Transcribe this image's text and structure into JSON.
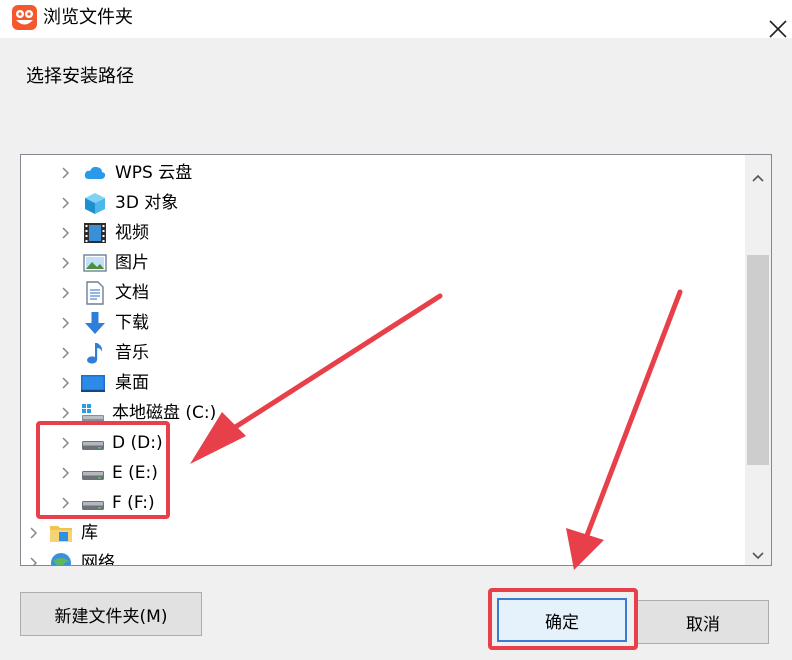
{
  "window": {
    "title": "浏览文件夹",
    "close_icon": "close-icon",
    "app_icon": "app-logo-icon"
  },
  "dialog": {
    "instruction": "选择安装路径"
  },
  "tree": {
    "items": [
      {
        "label": "WPS 云盘",
        "icon": "cloud-icon"
      },
      {
        "label": "3D 对象",
        "icon": "cube-icon"
      },
      {
        "label": "视频",
        "icon": "film-icon"
      },
      {
        "label": "图片",
        "icon": "picture-icon"
      },
      {
        "label": "文档",
        "icon": "document-icon"
      },
      {
        "label": "下载",
        "icon": "download-arrow-icon"
      },
      {
        "label": "音乐",
        "icon": "music-note-icon"
      },
      {
        "label": "桌面",
        "icon": "desktop-icon"
      },
      {
        "label": "本地磁盘 (C:)",
        "icon": "system-drive-icon"
      },
      {
        "label": "D (D:)",
        "icon": "drive-icon"
      },
      {
        "label": "E (E:)",
        "icon": "drive-icon"
      },
      {
        "label": "F (F:)",
        "icon": "drive-icon"
      },
      {
        "label": "库",
        "icon": "library-folder-icon"
      },
      {
        "label": "网络",
        "icon": "network-icon"
      }
    ]
  },
  "buttons": {
    "new_folder": "新建文件夹(M)",
    "ok": "确定",
    "cancel": "取消"
  },
  "colors": {
    "annotation": "#e8404a",
    "accent": "#3a7bd5"
  }
}
